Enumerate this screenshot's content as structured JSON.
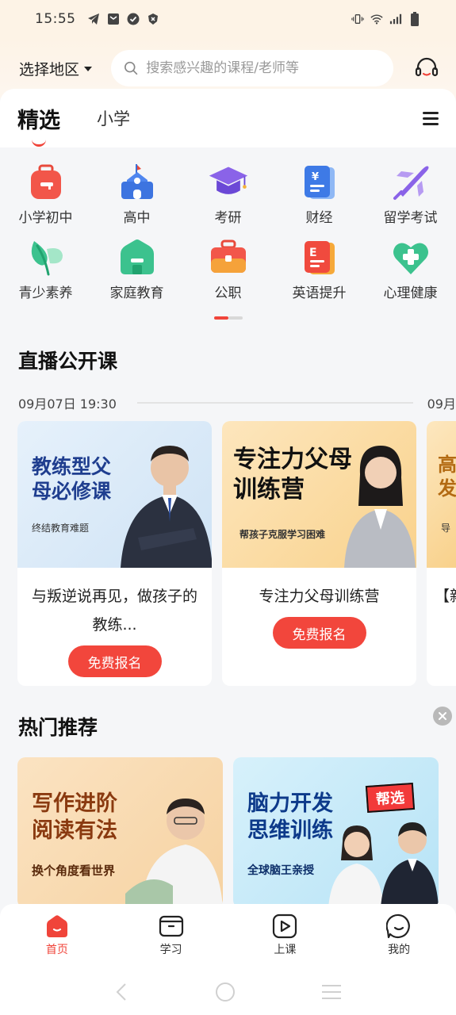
{
  "status": {
    "time": "15:55"
  },
  "header": {
    "region_label": "选择地区",
    "search_placeholder": "搜索感兴趣的课程/老师等"
  },
  "tabs": [
    {
      "label": "精选",
      "active": true
    },
    {
      "label": "小学",
      "active": false
    }
  ],
  "categories": [
    {
      "label": "小学初中",
      "icon": "backpack-icon"
    },
    {
      "label": "高中",
      "icon": "school-icon"
    },
    {
      "label": "考研",
      "icon": "graduation-cap-icon"
    },
    {
      "label": "财经",
      "icon": "finance-book-icon"
    },
    {
      "label": "留学考试",
      "icon": "airplane-icon"
    },
    {
      "label": "青少素养",
      "icon": "leaf-icon"
    },
    {
      "label": "家庭教育",
      "icon": "house-icon"
    },
    {
      "label": "公职",
      "icon": "briefcase-icon"
    },
    {
      "label": "英语提升",
      "icon": "english-book-icon"
    },
    {
      "label": "心理健康",
      "icon": "heart-plus-icon"
    }
  ],
  "live": {
    "section_title": "直播公开课",
    "time1": "09月07日 19:30",
    "time2": "09月",
    "cards": [
      {
        "cover_title": "教练型父母必修课",
        "cover_sub": "终结教育难题",
        "title": "与叛逆说再见，做孩子的教练...",
        "button": "免费报名"
      },
      {
        "cover_title": "专注力父母训练营",
        "cover_sub": "帮孩子克服学习困难",
        "title": "专注力父母训练营",
        "button": "免费报名"
      },
      {
        "cover_title": "高发",
        "cover_sub": "导",
        "title": "【新"
      }
    ]
  },
  "hot": {
    "section_title": "热门推荐",
    "cards": [
      {
        "title": "写作进阶阅读有法",
        "sub": "换个角度看世界"
      },
      {
        "title": "脑力开发思维训练",
        "sub": "全球脑王亲授",
        "badge": "帮选"
      }
    ]
  },
  "nav": [
    {
      "label": "首页",
      "icon": "home-icon",
      "active": true
    },
    {
      "label": "学习",
      "icon": "book-icon",
      "active": false
    },
    {
      "label": "上课",
      "icon": "play-icon",
      "active": false
    },
    {
      "label": "我的",
      "icon": "profile-icon",
      "active": false
    }
  ],
  "colors": {
    "accent": "#f0443a",
    "header_bg": "#fdf3e6",
    "page_bg": "#f5f6f8"
  }
}
